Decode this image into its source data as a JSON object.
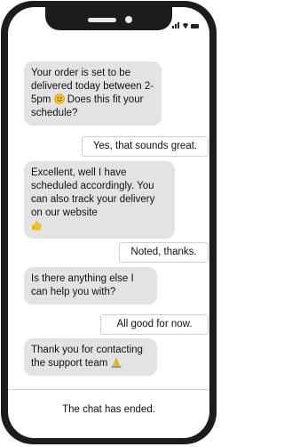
{
  "status_bar": {
    "icons": [
      "signal-icon",
      "wifi-icon",
      "battery-icon"
    ]
  },
  "chat": {
    "messages": [
      {
        "role": "agent",
        "text_1": "Your order is set to be delivered today between 2-5pm",
        "emoji": "smiling-face-icon",
        "text_2": " Does this fit your schedule?"
      },
      {
        "role": "user",
        "text": "Yes, that sounds great."
      },
      {
        "role": "agent",
        "text_1": "Excellent, well I have scheduled accordingly. You can also track your delivery on our website",
        "emoji": "thumbs-up-icon"
      },
      {
        "role": "user",
        "text": "Noted, thanks."
      },
      {
        "role": "agent",
        "text": "Is there anything else I can help you with?"
      },
      {
        "role": "user",
        "text": "All good for now."
      },
      {
        "role": "agent",
        "text_1": "Thank you for contacting the support team",
        "emoji": "folded-hands-icon"
      }
    ],
    "ended_text": "The chat has ended."
  },
  "colors": {
    "agent_bubble": "#e3e3e3",
    "user_bubble_border": "#cfcfcf",
    "phone_frame": "#1c1c1c"
  }
}
